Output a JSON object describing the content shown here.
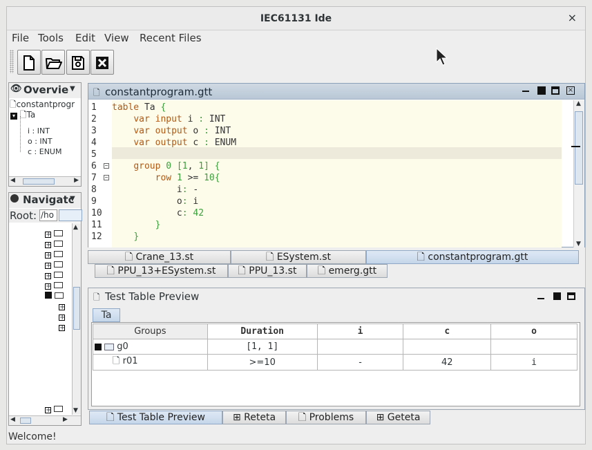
{
  "window": {
    "title": "IEC61131 Ide",
    "close": "×"
  },
  "menu": [
    "File",
    "Tools",
    "Edit",
    "View",
    "Recent Files"
  ],
  "toolbar": {
    "buttons": [
      "new-file-icon",
      "open-folder-icon",
      "save-icon",
      "close-icon"
    ]
  },
  "overview": {
    "title": "Overvie",
    "tree": {
      "root": "constantprogr",
      "table": "Ta",
      "vars": [
        "i : INT",
        "o : INT",
        "c : ENUM"
      ]
    }
  },
  "navigator": {
    "title": "Navigatc",
    "root_label": "Root:",
    "root_value": "/ho"
  },
  "editor": {
    "title": "constantprogram.gtt",
    "lines": [
      {
        "n": "1",
        "t": "table Ta {"
      },
      {
        "n": "2",
        "t": "    var input i : INT"
      },
      {
        "n": "3",
        "t": "    var output o : INT"
      },
      {
        "n": "4",
        "t": "    var output c : ENUM"
      },
      {
        "n": "5",
        "t": ""
      },
      {
        "n": "6",
        "t": "    group 0 [1, 1] {"
      },
      {
        "n": "7",
        "t": "        row 1 >= 10{"
      },
      {
        "n": "8",
        "t": "            i: -"
      },
      {
        "n": "9",
        "t": "            o: i"
      },
      {
        "n": "10",
        "t": "            c: 42"
      },
      {
        "n": "11",
        "t": "        }"
      },
      {
        "n": "12",
        "t": "    }"
      }
    ],
    "tabs_row1": [
      "Crane_13.st",
      "ESystem.st",
      "constantprogram.gtt"
    ],
    "tabs_row2": [
      "PPU_13+ESystem.st",
      "PPU_13.st",
      "emerg.gtt"
    ]
  },
  "preview": {
    "title": "Test Table Preview",
    "subtab": "Ta",
    "headers": [
      "Groups",
      "Duration",
      "i",
      "c",
      "o"
    ],
    "rows": [
      {
        "name": "g0",
        "duration": "[1, 1]",
        "i": "",
        "c": "",
        "o": ""
      },
      {
        "name": "r01",
        "duration": ">=10",
        "i": "-",
        "c": "42",
        "o": "i"
      }
    ]
  },
  "bottom_tabs": [
    "Test Table Preview",
    "Reteta",
    "Problems",
    "Geteta"
  ],
  "status": "Welcome!"
}
